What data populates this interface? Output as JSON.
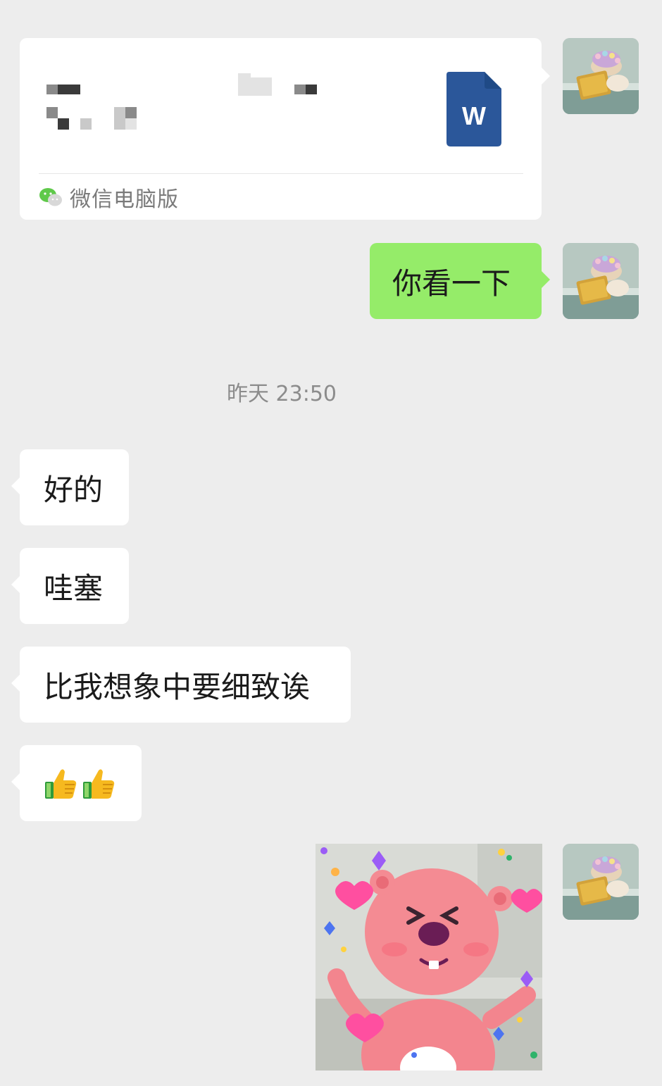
{
  "chat": {
    "file_message": {
      "source_label": "微信电脑版",
      "file_type_letter": "W",
      "icon": "word-document-icon",
      "source_icon": "wechat-logo-icon"
    },
    "sent_text": "你看一下",
    "timestamp": "昨天 23:50",
    "received": [
      "好的",
      "哇塞",
      "比我想象中要细致诶"
    ],
    "emoji_message": [
      "thumbs-up-emoji",
      "thumbs-up-emoji"
    ],
    "sticker": "pink-beaver-with-hearts-sticker",
    "avatar": "cat-reading-book-avatar",
    "colors": {
      "background": "#ededed",
      "sent_bubble": "#95ec69",
      "received_bubble": "#ffffff",
      "word_blue": "#2b579a"
    }
  }
}
